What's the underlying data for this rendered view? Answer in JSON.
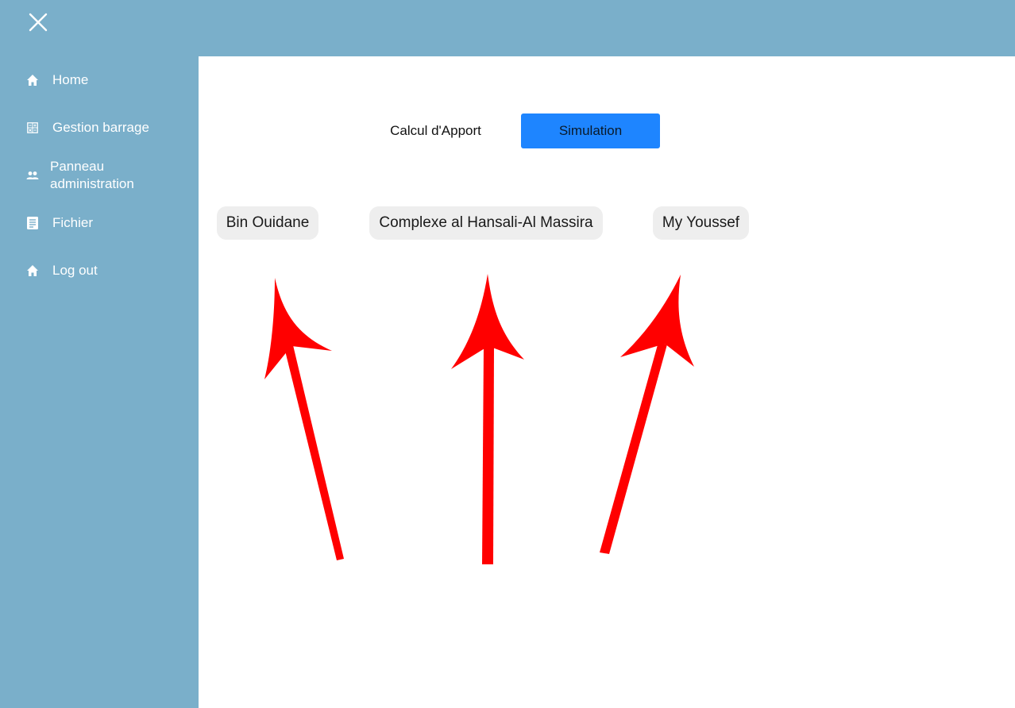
{
  "header": {
    "close_icon": "close-icon"
  },
  "sidebar": {
    "items": [
      {
        "label": "Home",
        "icon": "home-icon"
      },
      {
        "label": "Gestion barrage",
        "icon": "calculator-icon"
      },
      {
        "label": "Panneau administration",
        "icon": "people-icon"
      },
      {
        "label": "Fichier",
        "icon": "document-icon"
      },
      {
        "label": "Log out",
        "icon": "home-icon"
      }
    ]
  },
  "main": {
    "tabs": [
      {
        "label": "Calcul d'Apport",
        "active": false
      },
      {
        "label": "Simulation",
        "active": true
      }
    ],
    "dams": [
      {
        "label": "Bin Ouidane"
      },
      {
        "label": "Complexe al Hansali-Al Massira"
      },
      {
        "label": "My Youssef"
      }
    ]
  },
  "colors": {
    "sidebar_bg": "#7aafca",
    "main_bg": "#ffffff",
    "active_tab": "#1e85ff",
    "chip_bg": "#eeeeee",
    "annotation_arrow": "#ff0000"
  }
}
